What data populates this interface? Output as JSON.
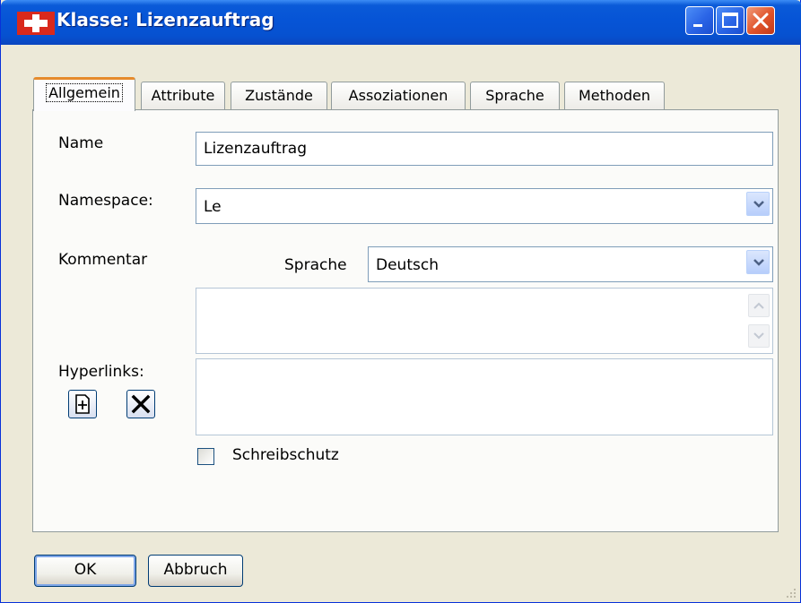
{
  "window": {
    "title": "Klasse: Lizenzauftrag",
    "app_icon": "red-cross-icon",
    "controls": [
      "minimize-icon",
      "maximize-icon",
      "close-icon"
    ]
  },
  "tabs": [
    {
      "label": "Allgemein",
      "active": true
    },
    {
      "label": "Attribute",
      "active": false
    },
    {
      "label": "Zustände",
      "active": false
    },
    {
      "label": "Assoziationen",
      "active": false
    },
    {
      "label": "Sprache",
      "active": false
    },
    {
      "label": "Methoden",
      "active": false
    }
  ],
  "form": {
    "name_label": "Name",
    "name_value": "Lizenzauftrag",
    "namespace_label": "Namespace:",
    "namespace_value": "Le",
    "kommentar_label": "Kommentar",
    "sprache_label": "Sprache",
    "sprache_value": "Deutsch",
    "kommentar_value": "",
    "hyperlinks_label": "Hyperlinks:",
    "hyperlinks_value": "",
    "hyperlink_add_icon": "add-page-icon",
    "hyperlink_delete_icon": "delete-x-icon",
    "readonly_label": "Schreibschutz",
    "readonly_checked": false
  },
  "buttons": {
    "ok": "OK",
    "cancel": "Abbruch"
  },
  "colors": {
    "titlebar": "#0654d6",
    "dialog_bg": "#ece9d8",
    "active_tab_accent": "#e68b2c",
    "close_button": "#e0532a"
  }
}
